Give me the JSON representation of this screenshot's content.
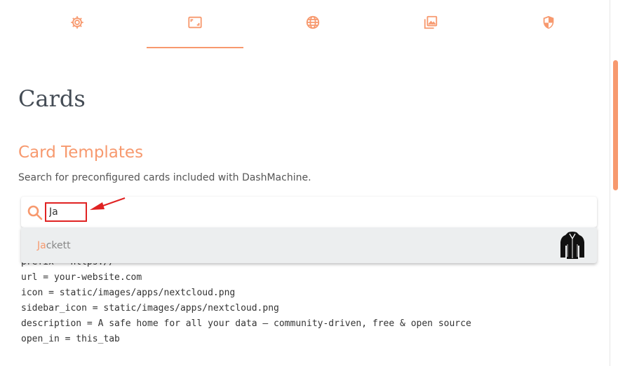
{
  "tabs": [
    {
      "icon": "gear-icon",
      "active": false
    },
    {
      "icon": "image-frame-icon",
      "active": true
    },
    {
      "icon": "globe-icon",
      "active": false
    },
    {
      "icon": "photo-library-icon",
      "active": false
    },
    {
      "icon": "shield-icon",
      "active": false
    }
  ],
  "colors": {
    "accent": "#f7996e",
    "title": "#444c55",
    "highlight_box": "#e02222"
  },
  "page": {
    "title": "Cards",
    "section_title": "Card Templates",
    "description": "Search for preconfigured cards included with DashMachine."
  },
  "search": {
    "value": "Ja",
    "placeholder": ""
  },
  "dropdown": {
    "items": [
      {
        "match": "Ja",
        "rest": "ckett",
        "icon": "jackett-icon"
      }
    ]
  },
  "code_lines": [
    "prefix = https://",
    "url = your-website.com",
    "icon = static/images/apps/nextcloud.png",
    "sidebar_icon = static/images/apps/nextcloud.png",
    "description = A safe home for all your data – community-driven, free & open source",
    "open_in = this_tab"
  ]
}
